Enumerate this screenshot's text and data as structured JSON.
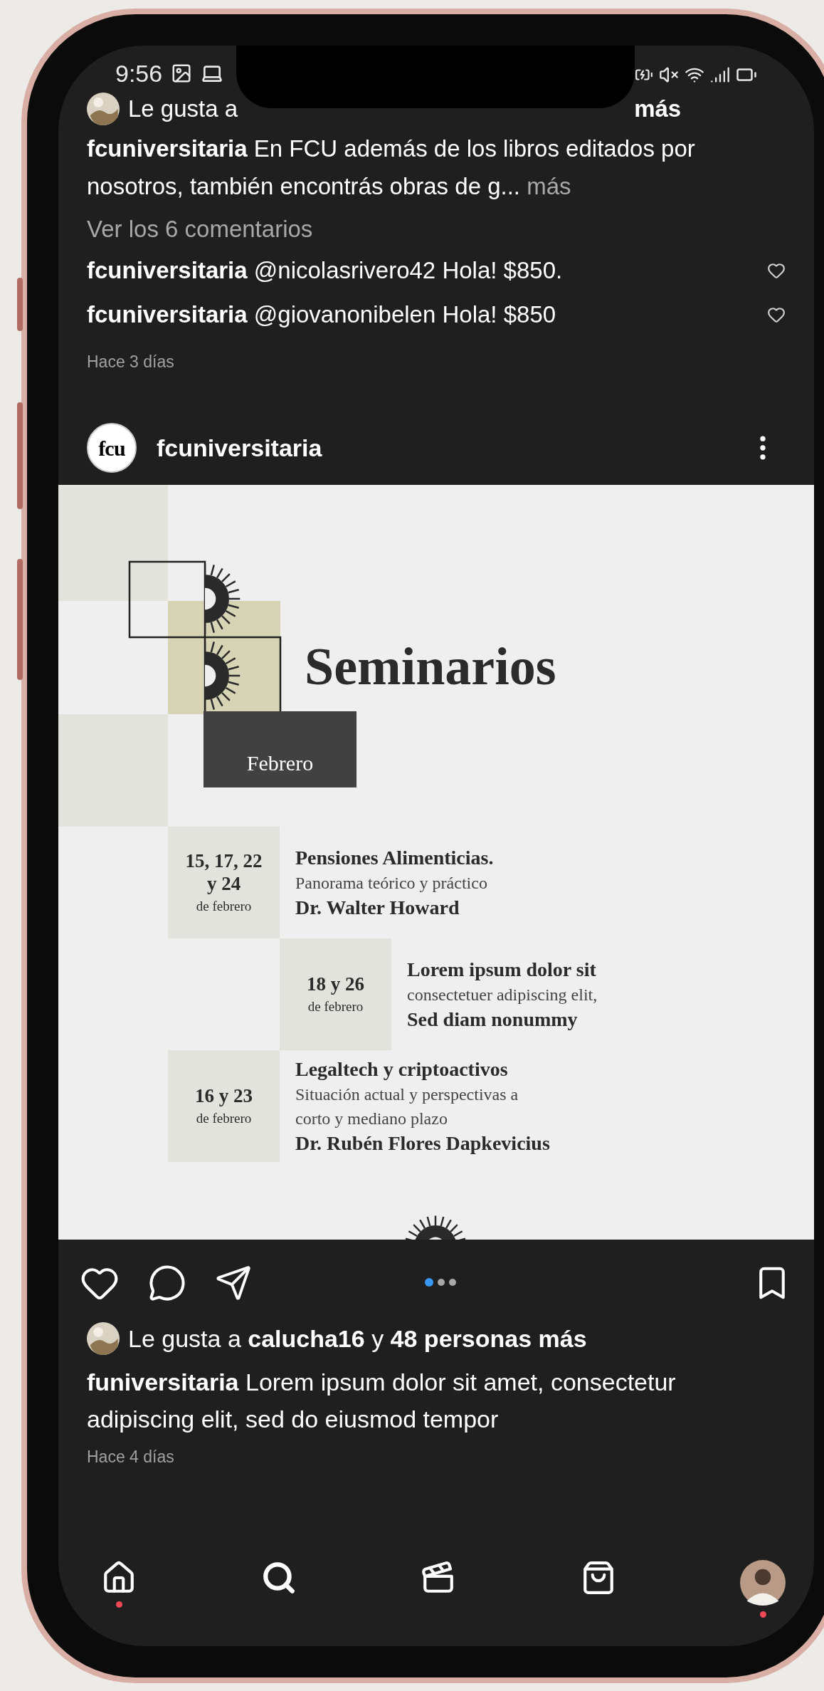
{
  "status_bar": {
    "time": "9:56"
  },
  "previous_post": {
    "likes_start": "Le gusta a",
    "likes_end": "más",
    "caption": "**fcuniversitaria** En FCU además de los libros editados por nosotros, también encontrás obras de g...",
    "more": "más",
    "view_comments": "Ver los 6 comentarios",
    "comments": [
      {
        "text": "**fcuniversitaria** @nicolasrivero42 Hola! $850.",
        "liked": false
      },
      {
        "text": "**fcuniversitaria** @giovanonibelen Hola! $850",
        "liked": false
      }
    ],
    "time": "Hace 3 días"
  },
  "post": {
    "username": "fcuniversitaria",
    "avatar_text": "fcu",
    "poster": {
      "title": "Seminarios",
      "month": "Febrero",
      "sessions": [
        {
          "dates": [
            "15, 17, 22",
            "y 24"
          ],
          "date_note": "de febrero",
          "title": "Pensiones Alimenticias.",
          "lines": [
            "Panorama teórico y práctico"
          ],
          "speaker": "Dr. Walter Howard",
          "kind": "flush"
        },
        {
          "dates": [
            "18 y 26"
          ],
          "date_note": "de febrero",
          "title": "Lorem ipsum dolor sit",
          "lines": [
            "consectetuer adipiscing elit,"
          ],
          "speaker": "Sed diam nonummy",
          "kind": "indented"
        },
        {
          "dates": [
            "16 y 23"
          ],
          "date_note": "de febrero",
          "title": "Legaltech y criptoactivos",
          "lines": [
            "Situación actual y perspectivas a",
            "corto y mediano plazo"
          ],
          "speaker": "Dr. Rubén Flores Dapkevicius",
          "kind": "flush"
        }
      ]
    },
    "carousel": [
      {
        "selected": true
      },
      {
        "selected": false
      },
      {
        "selected": false
      }
    ],
    "saved": false,
    "likes": "Le gusta a **calucha16** y **48 personas más**",
    "caption": "**funiversitaria** Lorem ipsum dolor sit amet, consectetur adipiscing elit, sed do eiusmod tempor",
    "time": "Hace 4 días"
  },
  "nav": [
    {
      "kind": "home",
      "dot": true
    },
    {
      "kind": "search",
      "dot": false
    },
    {
      "kind": "reels",
      "dot": false
    },
    {
      "kind": "shop",
      "dot": false
    },
    {
      "kind": "profile",
      "dot": true
    }
  ]
}
